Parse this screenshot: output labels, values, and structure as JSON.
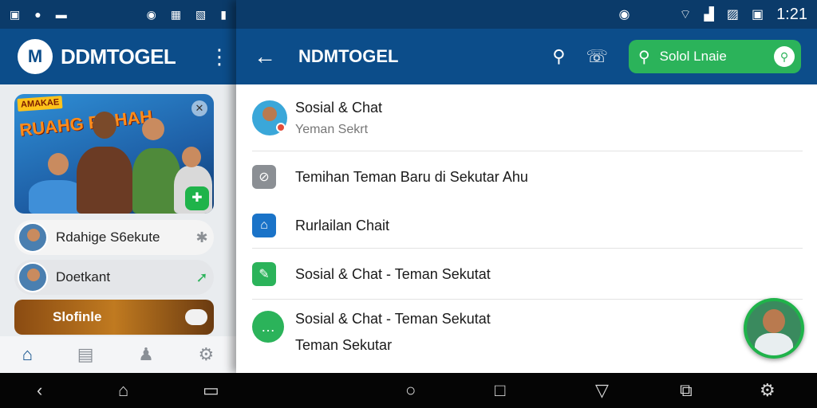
{
  "left": {
    "app_title": "DDMTOGEL",
    "logo_text": "M",
    "banner": {
      "tag": "AMAKAE",
      "headline": "RUAHG ROHAH"
    },
    "cards": [
      {
        "label": "Rdahige S6ekute"
      },
      {
        "label": "Doetkant"
      },
      {
        "label": "Slofinle"
      }
    ]
  },
  "right": {
    "status_time": "1:21",
    "title": "NDMTOGEL",
    "search_placeholder": "Solol Lnaie",
    "list": [
      {
        "label": "Sosial & Chat",
        "sub": "Yeman Sekrt"
      },
      {
        "label": "Temihan Teman Baru di Sekutar Ahu"
      },
      {
        "label": "Rurlailan Chait"
      },
      {
        "label": "Sosial & Chat - Teman Sekutat"
      },
      {
        "label": "Sosial & Chat - Teman Sekutat",
        "sub": "Teman Sekutar"
      }
    ]
  },
  "colors": {
    "primary": "#0c4d8a",
    "status_bar": "#0b3b6a",
    "accent_green": "#2bb35a",
    "icon_gray": "#8b8f94",
    "icon_blue": "#1a73c8"
  },
  "icons": {
    "left_status": [
      "app-icon",
      "pin-icon",
      "mail-icon",
      "clock-icon",
      "calendar-icon",
      "image-icon",
      "battery-icon"
    ],
    "right_status": [
      "mic-icon",
      "wifi-icon",
      "signal-icon",
      "no-signal-icon",
      "photo-icon"
    ],
    "left_tabs": [
      "home-icon",
      "bag-icon",
      "person-icon",
      "settings-icon"
    ],
    "navbar": [
      "back-icon",
      "home-icon",
      "recents-icon",
      "circle-icon",
      "square-icon",
      "triangle-icon",
      "tabs-icon",
      "settings-icon"
    ]
  }
}
